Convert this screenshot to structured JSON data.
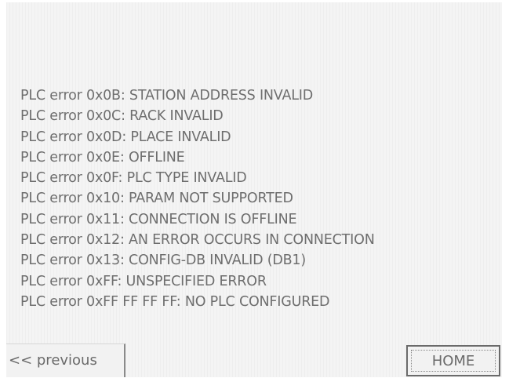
{
  "errors": [
    {
      "code": "PLC error 0x0B",
      "message": "STATION ADDRESS INVALID"
    },
    {
      "code": "PLC error 0x0C",
      "message": "RACK INVALID"
    },
    {
      "code": "PLC error 0x0D",
      "message": "PLACE INVALID"
    },
    {
      "code": "PLC error 0x0E",
      "message": "OFFLINE"
    },
    {
      "code": "PLC error 0x0F",
      "message": "PLC TYPE INVALID"
    },
    {
      "code": "PLC error 0x10",
      "message": "PARAM NOT  SUPPORTED"
    },
    {
      "code": "PLC error 0x11",
      "message": "CONNECTION IS OFFLINE"
    },
    {
      "code": "PLC error 0x12",
      "message": "AN ERROR OCCURS IN CONNECTION"
    },
    {
      "code": "PLC error 0x13",
      "message": "CONFIG-DB INVALID (DB1)"
    },
    {
      "code": "PLC error 0xFF",
      "message": "UNSPECIFIED ERROR"
    },
    {
      "code": "PLC error 0xFF FF FF FF",
      "message": "NO PLC CONFIGURED"
    }
  ],
  "nav": {
    "previous_label": "<< previous",
    "home_label": "HOME"
  },
  "colors": {
    "screen_background": "#f4f4f4",
    "text": "#6e6e6e",
    "button_border": "#6a6a6a"
  }
}
